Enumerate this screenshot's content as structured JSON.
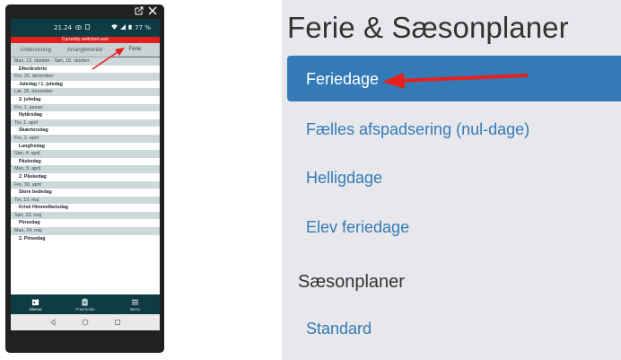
{
  "phone": {
    "status_time": "21.24",
    "status_battery": "77 %",
    "banner": "Currently switched user",
    "tabs": [
      {
        "label": "Undervisning"
      },
      {
        "label": "Arrangementer"
      },
      {
        "label": "Ferie"
      }
    ],
    "days": [
      {
        "date": "Man, 12. oktober - Søn, 18. oktober",
        "name": "Efterårsferie"
      },
      {
        "date": "Fre, 25. december",
        "name": "Juledag / 1. juledag"
      },
      {
        "date": "Lør, 26. december",
        "name": "2. juledag"
      },
      {
        "date": "Fre, 1. januar",
        "name": "Nytårsdag"
      },
      {
        "date": "Tor, 1. april",
        "name": "Skærtorsdag"
      },
      {
        "date": "Fre, 2. april",
        "name": "Langfredag"
      },
      {
        "date": "Søn, 4. april",
        "name": "Påskedag"
      },
      {
        "date": "Man, 5. april",
        "name": "2. Påskedag"
      },
      {
        "date": "Fre, 30. april",
        "name": "Store bededag"
      },
      {
        "date": "Tor, 13. maj",
        "name": "Kristi Himmelfartsdag"
      },
      {
        "date": "Søn, 23. maj",
        "name": "Pinsedag"
      },
      {
        "date": "Man, 24. maj",
        "name": "2. Pinsedag"
      }
    ],
    "nav": [
      {
        "label": "Skema",
        "icon": "calendar-icon"
      },
      {
        "label": "Fravmelde",
        "icon": "clipboard-icon"
      },
      {
        "label": "Menu",
        "icon": "hamburger-menu-icon"
      }
    ]
  },
  "menu": {
    "title": "Ferie & Sæsonplaner",
    "items": [
      {
        "label": "Feriedage",
        "active": true
      },
      {
        "label": "Fælles afspadsering (nul-dage)"
      },
      {
        "label": "Helligdage"
      },
      {
        "label": "Elev feriedage"
      }
    ],
    "section_heading": "Sæsonplaner",
    "section_items": [
      {
        "label": "Standard"
      }
    ]
  },
  "colors": {
    "accent_blue": "#337ab7",
    "annotation_red": "#e8201c",
    "app_dark": "#0f3b43",
    "panel_bg": "#e8e8ec"
  }
}
